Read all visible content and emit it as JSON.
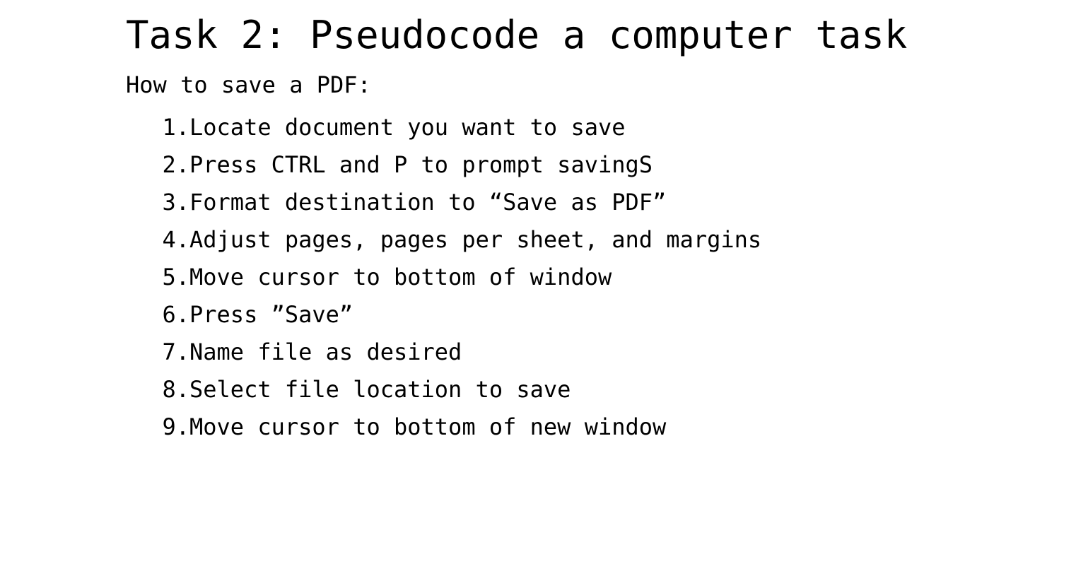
{
  "slide": {
    "title": "Task 2: Pseudocode a computer task",
    "intro": "How to save a PDF:",
    "steps": [
      {
        "num": "1.",
        "text": "Locate document you want to save"
      },
      {
        "num": "2.",
        "text": "Press CTRL and P to prompt savingS"
      },
      {
        "num": "3.",
        "text": "Format destination to “Save as PDF”"
      },
      {
        "num": "4.",
        "text": "Adjust pages, pages per sheet, and margins"
      },
      {
        "num": "5.",
        "text": "Move cursor to bottom of window"
      },
      {
        "num": "6.",
        "text": "Press ”Save”"
      },
      {
        "num": "7.",
        "text": "Name file as desired"
      },
      {
        "num": "8.",
        "text": "Select file location to save"
      },
      {
        "num": "9.",
        "text": "Move cursor to bottom of new window"
      }
    ]
  }
}
